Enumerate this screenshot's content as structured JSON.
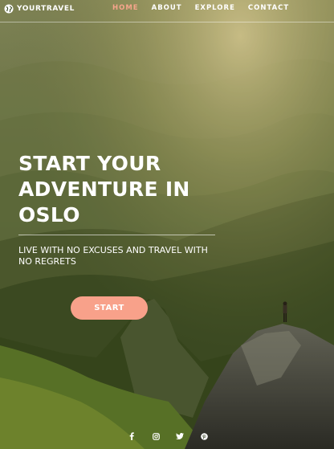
{
  "brand": {
    "name": "YOURTRAVEL",
    "icon": "globe-icon"
  },
  "nav": {
    "items": [
      {
        "label": "HOME",
        "active": true
      },
      {
        "label": "ABOUT",
        "active": false
      },
      {
        "label": "EXPLORE",
        "active": false
      },
      {
        "label": "CONTACT",
        "active": false
      }
    ]
  },
  "hero": {
    "headline_lines": [
      "START YOUR",
      "ADVENTURE IN",
      "OSLO"
    ],
    "tagline": "LIVE WITH NO EXCUSES AND TRAVEL WITH NO REGRETS",
    "cta_label": "START"
  },
  "socials": [
    "facebook-icon",
    "instagram-icon",
    "twitter-icon",
    "pinterest-icon"
  ],
  "colors": {
    "accent": "#f8a18a",
    "active_nav": "#f6a58c",
    "text": "#ffffff"
  }
}
